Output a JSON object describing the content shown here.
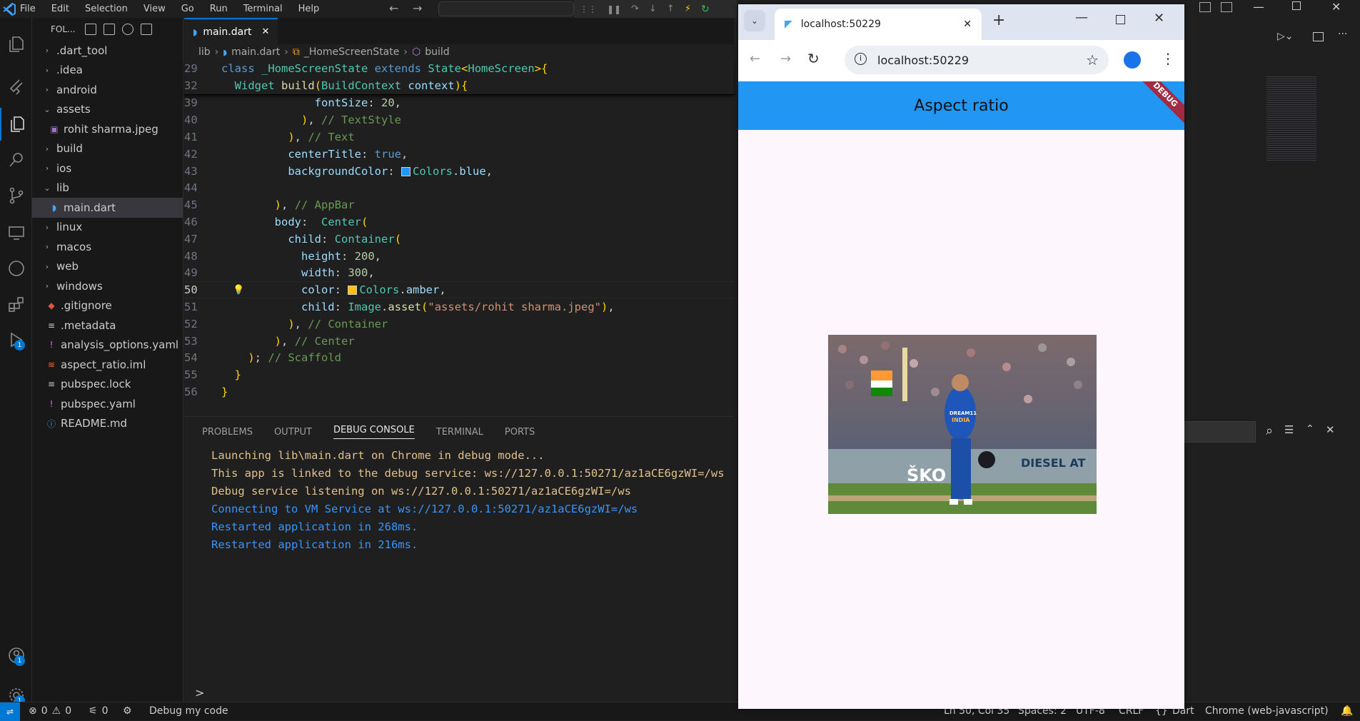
{
  "menu": [
    "File",
    "Edit",
    "Selection",
    "View",
    "Go",
    "Run",
    "Terminal",
    "Help"
  ],
  "explorer": {
    "title": "FOL...",
    "items": [
      {
        "label": ".dart_tool",
        "type": "folder",
        "open": false,
        "indent": 0
      },
      {
        "label": ".idea",
        "type": "folder",
        "open": false,
        "indent": 0
      },
      {
        "label": "android",
        "type": "folder",
        "open": false,
        "indent": 0
      },
      {
        "label": "assets",
        "type": "folder",
        "open": true,
        "indent": 0
      },
      {
        "label": "rohit sharma.jpeg",
        "type": "image",
        "indent": 1
      },
      {
        "label": "build",
        "type": "folder",
        "open": false,
        "indent": 0
      },
      {
        "label": "ios",
        "type": "folder",
        "open": false,
        "indent": 0
      },
      {
        "label": "lib",
        "type": "folder",
        "open": true,
        "indent": 0
      },
      {
        "label": "main.dart",
        "type": "dart",
        "indent": 1,
        "selected": true
      },
      {
        "label": "linux",
        "type": "folder",
        "open": false,
        "indent": 0
      },
      {
        "label": "macos",
        "type": "folder",
        "open": false,
        "indent": 0
      },
      {
        "label": "web",
        "type": "folder",
        "open": false,
        "indent": 0
      },
      {
        "label": "windows",
        "type": "folder",
        "open": false,
        "indent": 0
      },
      {
        "label": ".gitignore",
        "type": "git",
        "indent": 0
      },
      {
        "label": ".metadata",
        "type": "text",
        "indent": 0
      },
      {
        "label": "analysis_options.yaml",
        "type": "yaml",
        "indent": 0
      },
      {
        "label": "aspect_ratio.iml",
        "type": "iml",
        "indent": 0
      },
      {
        "label": "pubspec.lock",
        "type": "text",
        "indent": 0
      },
      {
        "label": "pubspec.yaml",
        "type": "yaml",
        "indent": 0
      },
      {
        "label": "README.md",
        "type": "info",
        "indent": 0
      }
    ]
  },
  "editor": {
    "tab": "main.dart",
    "breadcrumb": [
      "lib",
      "main.dart",
      "_HomeScreenState",
      "build"
    ],
    "sticky": [
      {
        "n": "29",
        "code": "class _HomeScreenState extends State<HomeScreen>{"
      },
      {
        "n": "32",
        "code": "  Widget build(BuildContext context){"
      }
    ],
    "lines": [
      {
        "n": "39",
        "code": "              fontSize: 20,"
      },
      {
        "n": "40",
        "code": "            ), // TextStyle"
      },
      {
        "n": "41",
        "code": "          ), // Text"
      },
      {
        "n": "42",
        "code": "          centerTitle: true,"
      },
      {
        "n": "43",
        "code": "          backgroundColor: Colors.blue,"
      },
      {
        "n": "44",
        "code": ""
      },
      {
        "n": "45",
        "code": "        ), // AppBar"
      },
      {
        "n": "46",
        "code": "        body:  Center("
      },
      {
        "n": "47",
        "code": "          child: Container("
      },
      {
        "n": "48",
        "code": "            height: 200,"
      },
      {
        "n": "49",
        "code": "            width: 300,"
      },
      {
        "n": "50",
        "code": "            color: Colors.amber,"
      },
      {
        "n": "51",
        "code": "            child: Image.asset(\"assets/rohit sharma.jpeg\"),"
      },
      {
        "n": "52",
        "code": "          ), // Container"
      },
      {
        "n": "53",
        "code": "        ), // Center"
      },
      {
        "n": "54",
        "code": "    ); // Scaffold"
      },
      {
        "n": "55",
        "code": "  }"
      },
      {
        "n": "56",
        "code": "}"
      }
    ],
    "current_line": "50"
  },
  "panel": {
    "tabs": [
      "PROBLEMS",
      "OUTPUT",
      "DEBUG CONSOLE",
      "TERMINAL",
      "PORTS"
    ],
    "active": "DEBUG CONSOLE",
    "console": [
      {
        "text": "Launching lib\\main.dart on Chrome in debug mode...",
        "color": "yel"
      },
      {
        "text": "This app is linked to the debug service: ws://127.0.0.1:50271/az1aCE6gzWI=/ws",
        "color": "yel"
      },
      {
        "text": "Debug service listening on ws://127.0.0.1:50271/az1aCE6gzWI=/ws",
        "color": "yel"
      },
      {
        "text": "Connecting to VM Service at ws://127.0.0.1:50271/az1aCE6gzWI=/ws",
        "color": "blu"
      },
      {
        "text": "Restarted application in 268ms.",
        "color": "blu"
      },
      {
        "text": "Restarted application in 216ms.",
        "color": "blu"
      }
    ],
    "prompt": ">"
  },
  "status": {
    "errors": "0",
    "warnings": "0",
    "ports": "0",
    "debug": "Debug my code",
    "position": "Ln 50, Col 35",
    "spaces": "Spaces: 2",
    "encoding": "UTF-8",
    "eol": "CRLF",
    "language": "Dart",
    "device": "Chrome (web-javascript)"
  },
  "browser": {
    "tab_title": "localhost:50229",
    "url": "localhost:50229",
    "appbar_title": "Aspect ratio",
    "banner": "DEBUG",
    "appbar_color": "#2196f3",
    "image_label_1": "DREAM11",
    "image_label_2": "INDIA",
    "image_label_3": "DIESEL AT",
    "image_label_4": "ŠKO"
  },
  "badges": {
    "accounts": "1",
    "settings": "1",
    "debug": "1"
  }
}
